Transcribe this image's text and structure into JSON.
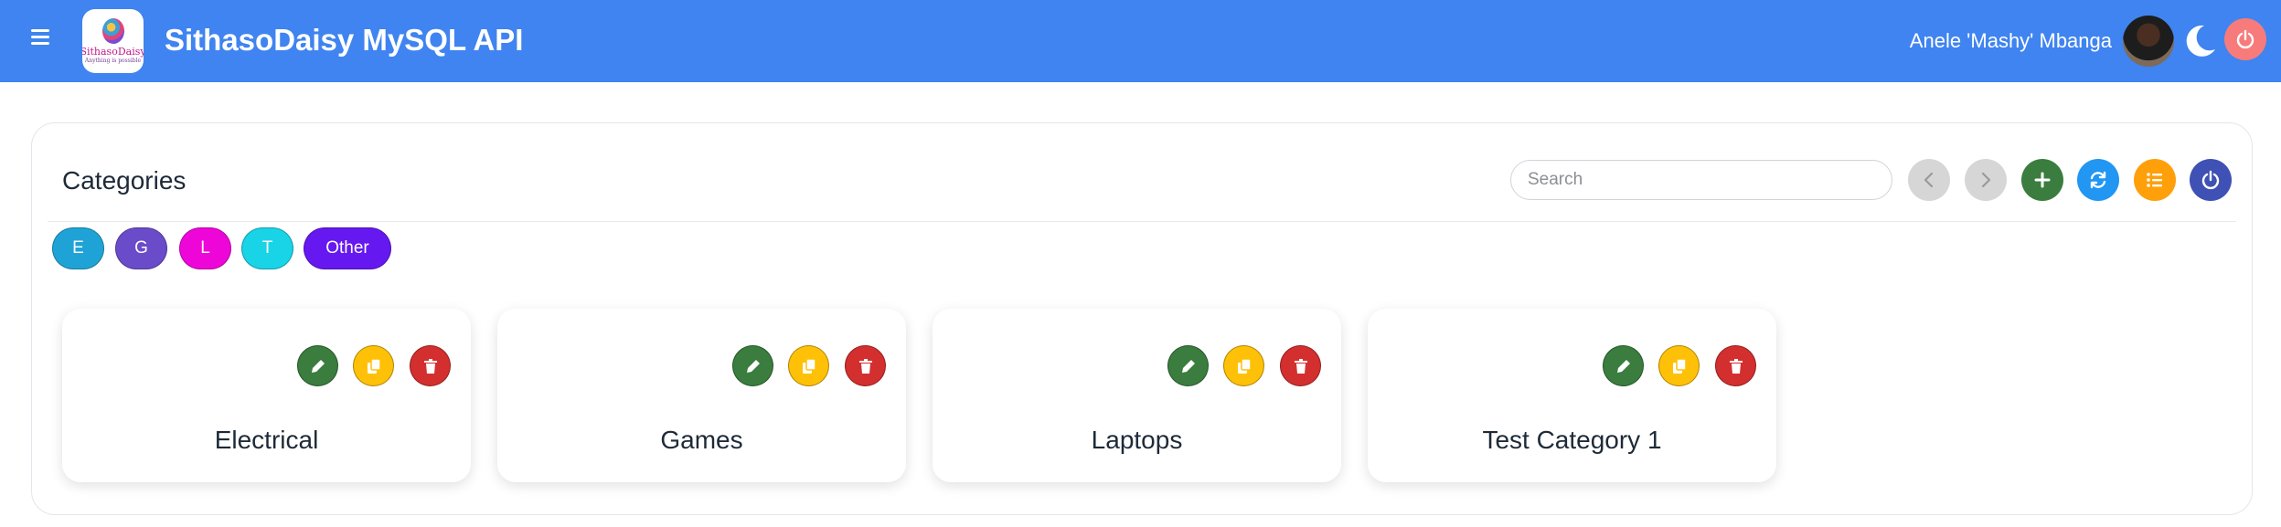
{
  "header": {
    "app_title": "SithasoDaisy MySQL API",
    "logo_name": "SithasoDaisy",
    "logo_tagline": "Anything is possible",
    "user_name": "Anele 'Mashy' Mbanga",
    "bg_color": "#3f84f0"
  },
  "panel": {
    "title": "Categories",
    "search_placeholder": "Search"
  },
  "toolbar": {
    "prev_icon": "chevron-left-icon",
    "next_icon": "chevron-right-icon",
    "add_icon": "plus-icon",
    "refresh_icon": "refresh-icon",
    "list_icon": "list-icon",
    "power_icon": "power-icon"
  },
  "filters": [
    {
      "label": "E",
      "color": "#1fa3d6"
    },
    {
      "label": "G",
      "color": "#6a4bc9"
    },
    {
      "label": "L",
      "color": "#ee06d8"
    },
    {
      "label": "T",
      "color": "#19d3e6"
    },
    {
      "label": "Other",
      "color": "#6618f0"
    }
  ],
  "categories": [
    {
      "name": "Electrical"
    },
    {
      "name": "Games"
    },
    {
      "name": "Laptops"
    },
    {
      "name": "Test Category 1"
    }
  ]
}
